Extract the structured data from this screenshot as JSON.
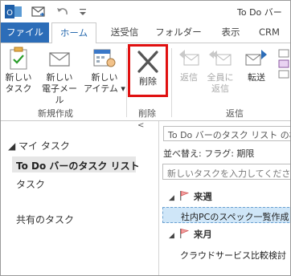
{
  "titlebar": {
    "title": "To Do バー"
  },
  "tabs": [
    {
      "label": "ファイル"
    },
    {
      "label": "ホーム"
    },
    {
      "label": "送受信"
    },
    {
      "label": "フォルダー"
    },
    {
      "label": "表示"
    },
    {
      "label": "CRM"
    }
  ],
  "ribbon": {
    "new_task": [
      "新しい",
      "タスク"
    ],
    "new_mail": [
      "新しい",
      "電子メール"
    ],
    "new_items": [
      "新しい",
      "アイテム ▾"
    ],
    "delete": "削除",
    "reply": "返信",
    "reply_all": [
      "全員に",
      "返信"
    ],
    "forward": "転送",
    "groups": {
      "new": "新規作成",
      "delete": "削除",
      "respond": "返信"
    }
  },
  "sidebar": {
    "header": "◢ マイ タスク",
    "selected": "To Do バーのタスク リスト",
    "task": "タスク",
    "shared": "共有のタスク"
  },
  "tasklist": {
    "search_placeholder": "To Do バーのタスク リスト の検索",
    "sort": "並べ替え: フラグ: 期限",
    "new_task_placeholder": "新しいタスクを入力してください",
    "groups": [
      {
        "label": "来週",
        "tasks": [
          "社内PCのスペック一覧作成"
        ]
      },
      {
        "label": "来月",
        "tasks": [
          "クラウドサービス比較検討"
        ]
      }
    ]
  },
  "colors": {
    "accent": "#2c6db8",
    "highlight": "#e01010",
    "selection": "#cfe6f8"
  }
}
